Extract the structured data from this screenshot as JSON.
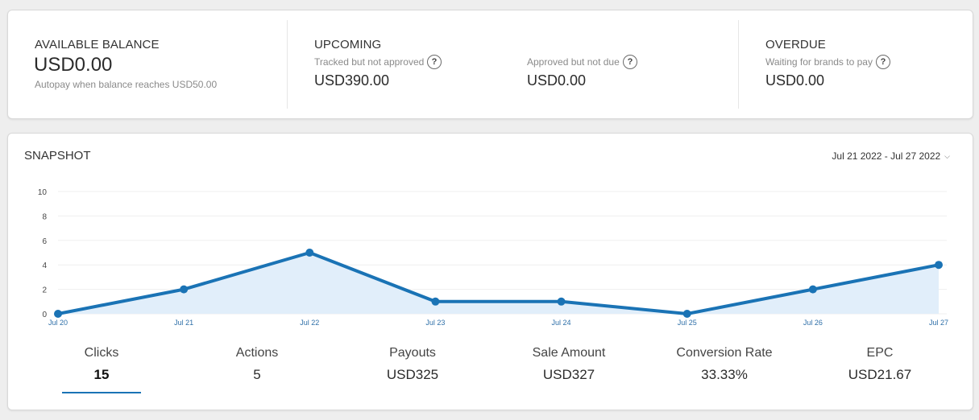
{
  "balance": {
    "available": {
      "title": "AVAILABLE BALANCE",
      "amount": "USD0.00",
      "note": "Autopay when balance reaches USD50.00"
    },
    "upcoming": {
      "title": "UPCOMING",
      "tracked_label": "Tracked but not approved",
      "tracked_amount": "USD390.00",
      "approved_label": "Approved but not due",
      "approved_amount": "USD0.00"
    },
    "overdue": {
      "title": "OVERDUE",
      "waiting_label": "Waiting for brands to pay",
      "waiting_amount": "USD0.00"
    },
    "help_glyph": "?",
    "help_icon_name": "question-circle-icon"
  },
  "snapshot": {
    "title": "SNAPSHOT",
    "date_range": "Jul 21 2022 - Jul 27 2022",
    "date_range_icon": "chevron-down-icon",
    "metrics": [
      {
        "label": "Clicks",
        "value": "15",
        "active": true
      },
      {
        "label": "Actions",
        "value": "5",
        "active": false
      },
      {
        "label": "Payouts",
        "value": "USD325",
        "active": false
      },
      {
        "label": "Sale Amount",
        "value": "USD327",
        "active": false
      },
      {
        "label": "Conversion Rate",
        "value": "33.33%",
        "active": false
      },
      {
        "label": "EPC",
        "value": "USD21.67",
        "active": false
      }
    ]
  },
  "chart_data": {
    "type": "area",
    "x": [
      "Jul 20",
      "Jul 21",
      "Jul 22",
      "Jul 23",
      "Jul 24",
      "Jul 25",
      "Jul 26",
      "Jul 27"
    ],
    "values": [
      0,
      2,
      5,
      1,
      1,
      0,
      2,
      4
    ],
    "y_ticks": [
      "0",
      "2",
      "4",
      "6",
      "8",
      "10"
    ],
    "ylim": [
      0,
      10
    ],
    "grid": true,
    "line_color": "#1a73b5",
    "fill_color": "#e1eefa"
  }
}
